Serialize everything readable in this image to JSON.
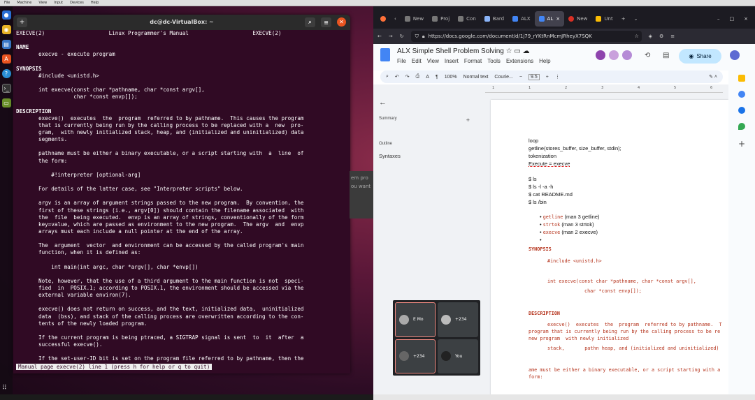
{
  "host_menu": [
    "File",
    "Machine",
    "View",
    "Input",
    "Devices",
    "Help"
  ],
  "terminal": {
    "title": "dc@dc-VirtualBox: ~",
    "new_tab": "+",
    "search_icon": "search-icon",
    "menu_icon": "hamburger-icon",
    "close_icon": "close-icon",
    "status_line": "Manual page execve(2) line 1 (press h for help or q to quit)",
    "lines": [
      "EXECVE(2)                    Linux Programmer's Manual                    EXECVE(2)",
      "",
      "NAME",
      "       execve - execute program",
      "",
      "SYNOPSIS",
      "       #include <unistd.h>",
      "",
      "       int execve(const char *pathname, char *const argv[],",
      "                  char *const envp[]);",
      "",
      "DESCRIPTION",
      "       execve()  executes  the  program  referred to by pathname.  This causes the program",
      "       that is currently being run by the calling process to be replaced with a  new  pro-",
      "       gram,  with newly initialized stack, heap, and (initialized and uninitialized) data",
      "       segments.",
      "",
      "       pathname must be either a binary executable, or a script starting with  a  line  of",
      "       the form:",
      "",
      "           #!interpreter [optional-arg]",
      "",
      "       For details of the latter case, see \"Interpreter scripts\" below.",
      "",
      "       argv is an array of argument strings passed to the new program.  By convention, the",
      "       first of these strings (i.e., argv[0]) should contain the filename associated  with",
      "       the  file  being executed.  envp is an array of strings, conventionally of the form",
      "       key=value, which are passed as environment to the new program.  The argv  and  envp",
      "       arrays must each include a null pointer at the end of the array.",
      "",
      "       The  argument  vector  and environment can be accessed by the called program's main",
      "       function, when it is defined as:",
      "",
      "           int main(int argc, char *argv[], char *envp[])",
      "",
      "       Note, however, that the use of a third argument to the main function is not  speci-",
      "       fied  in  POSIX.1; according to POSIX.1, the environment should be accessed via the",
      "       external variable environ(7).",
      "",
      "       execve() does not return on success, and the text, initialized data,  uninitialized",
      "       data  (bss), and stack of the calling process are overwritten according to the con-",
      "       tents of the newly loaded program.",
      "",
      "       If the current program is being ptraced, a SIGTRAP signal is sent  to  it  after  a",
      "       successful execve().",
      "",
      "       If the set-user-ID bit is set on the program file referred to by pathname, then the"
    ]
  },
  "ghost_popup": {
    "line1": "em pro",
    "line2": "ou want"
  },
  "browser": {
    "tabs": [
      {
        "label": "",
        "icon": "firefox-icon"
      },
      {
        "label": "New",
        "icon": "page-icon"
      },
      {
        "label": "Proj",
        "icon": "page-icon"
      },
      {
        "label": "Con",
        "icon": "page-icon"
      },
      {
        "label": "Bard",
        "icon": "bard-icon"
      },
      {
        "label": "ALX",
        "icon": "docs-icon"
      },
      {
        "label": "AL",
        "icon": "docs-icon",
        "active": true
      },
      {
        "label": "New",
        "icon": "page-icon"
      },
      {
        "label": "Unt",
        "icon": "page-icon"
      }
    ],
    "new_tab": "+",
    "url": "https://docs.google.com/document/d/1j79_rYKtRnMcmJRheyX7SQK",
    "window_controls": [
      "–",
      "□",
      "×"
    ]
  },
  "docs": {
    "title": "ALX Simple Shell Problem Solving",
    "menu": [
      "File",
      "Edit",
      "View",
      "Insert",
      "Format",
      "Tools",
      "Extensions",
      "Help"
    ],
    "share_label": "Share",
    "toolbar": {
      "zoom": "100%",
      "style": "Normal text",
      "font": "Courie...",
      "size": "9.5"
    },
    "ruler_marks": [
      "1",
      "1",
      "2",
      "3",
      "4",
      "5",
      "6"
    ],
    "outline": {
      "summary": "Summary",
      "outline_label": "Outline",
      "item": "Syntaxes",
      "add": "+"
    },
    "page": {
      "lines": [
        "loop",
        "getline(stores_buffer, size_buffer, stdin);",
        "tokenization",
        "Execute = execve"
      ],
      "cmds": [
        "$ ls",
        "$ ls -l -a -h",
        "$ cat README.md",
        "$ ls /bin"
      ],
      "bullets": [
        {
          "code": "getline",
          "text": " (man 3 getline)"
        },
        {
          "code": "strtok",
          "text": " (man 3 strtok)"
        },
        {
          "code": "execve",
          "text": " (man 2 execve)"
        },
        {
          "code": "",
          "text": ""
        }
      ],
      "synopsis_head": "SYNOPSIS",
      "include": "#include <unistd.h>",
      "proto1": "int execve(const char *pathname, char *const argv[],",
      "proto2": "char *const envp[]);",
      "desc_head": "DESCRIPTION",
      "desc1": "execve()  executes  the  program  referred to by pathname.  T",
      "desc2": "program that is currently being run by the calling process to be re",
      "desc3": "new program  with newly initialized",
      "desc4": "stack,       pathn heap, and (initialized and uninitialized)",
      "desc5": "ame must be either a binary executable, or a script starting with a",
      "desc6": "form:"
    }
  },
  "meet": {
    "tiles": [
      {
        "name": "E Mo",
        "highlight": true
      },
      {
        "name": "+234",
        "highlight": false
      },
      {
        "name": "+234",
        "highlight": true
      },
      {
        "name": "You",
        "highlight": false
      }
    ]
  }
}
